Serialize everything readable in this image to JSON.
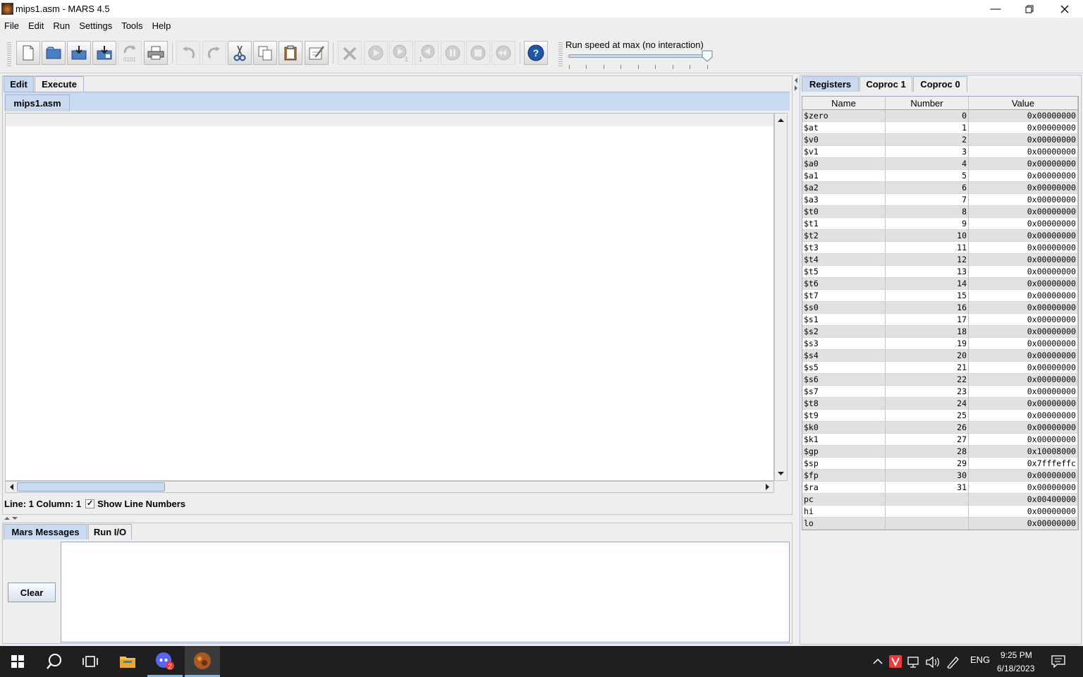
{
  "window": {
    "title": "mips1.asm  - MARS 4.5"
  },
  "menu": [
    "File",
    "Edit",
    "Run",
    "Settings",
    "Tools",
    "Help"
  ],
  "toolbar": {
    "speed_label": "Run speed at max (no interaction)",
    "speed_level_percent": 100,
    "assemble_glyph": "0101",
    "step_glyph": "1",
    "help_glyph": "?",
    "icons": [
      "new-file-icon",
      "open-icon",
      "save-icon",
      "save-as-icon",
      "dump-memory-icon",
      "print-icon",
      "undo-icon",
      "redo-icon",
      "cut-icon",
      "copy-icon",
      "paste-icon",
      "find-replace-icon",
      "assemble-icon",
      "run-icon",
      "step-icon",
      "backstep-icon",
      "pause-icon",
      "stop-icon",
      "reset-icon",
      "help-icon"
    ]
  },
  "left": {
    "tabs": {
      "edit": "Edit",
      "execute": "Execute"
    },
    "file_tab": "mips1.asm",
    "status": {
      "position": "Line: 1 Column: 1",
      "check_mark": "✓",
      "show_line_numbers": "Show Line Numbers"
    }
  },
  "messages": {
    "tabs": {
      "mars": "Mars Messages",
      "runio": "Run I/O"
    },
    "clear_label": "Clear"
  },
  "registers": {
    "tabs": {
      "registers": "Registers",
      "coproc1": "Coproc 1",
      "coproc0": "Coproc 0"
    },
    "headers": {
      "name": "Name",
      "number": "Number",
      "value": "Value"
    },
    "rows": [
      {
        "name": "$zero",
        "number": "0",
        "value": "0x00000000"
      },
      {
        "name": "$at",
        "number": "1",
        "value": "0x00000000"
      },
      {
        "name": "$v0",
        "number": "2",
        "value": "0x00000000"
      },
      {
        "name": "$v1",
        "number": "3",
        "value": "0x00000000"
      },
      {
        "name": "$a0",
        "number": "4",
        "value": "0x00000000"
      },
      {
        "name": "$a1",
        "number": "5",
        "value": "0x00000000"
      },
      {
        "name": "$a2",
        "number": "6",
        "value": "0x00000000"
      },
      {
        "name": "$a3",
        "number": "7",
        "value": "0x00000000"
      },
      {
        "name": "$t0",
        "number": "8",
        "value": "0x00000000"
      },
      {
        "name": "$t1",
        "number": "9",
        "value": "0x00000000"
      },
      {
        "name": "$t2",
        "number": "10",
        "value": "0x00000000"
      },
      {
        "name": "$t3",
        "number": "11",
        "value": "0x00000000"
      },
      {
        "name": "$t4",
        "number": "12",
        "value": "0x00000000"
      },
      {
        "name": "$t5",
        "number": "13",
        "value": "0x00000000"
      },
      {
        "name": "$t6",
        "number": "14",
        "value": "0x00000000"
      },
      {
        "name": "$t7",
        "number": "15",
        "value": "0x00000000"
      },
      {
        "name": "$s0",
        "number": "16",
        "value": "0x00000000"
      },
      {
        "name": "$s1",
        "number": "17",
        "value": "0x00000000"
      },
      {
        "name": "$s2",
        "number": "18",
        "value": "0x00000000"
      },
      {
        "name": "$s3",
        "number": "19",
        "value": "0x00000000"
      },
      {
        "name": "$s4",
        "number": "20",
        "value": "0x00000000"
      },
      {
        "name": "$s5",
        "number": "21",
        "value": "0x00000000"
      },
      {
        "name": "$s6",
        "number": "22",
        "value": "0x00000000"
      },
      {
        "name": "$s7",
        "number": "23",
        "value": "0x00000000"
      },
      {
        "name": "$t8",
        "number": "24",
        "value": "0x00000000"
      },
      {
        "name": "$t9",
        "number": "25",
        "value": "0x00000000"
      },
      {
        "name": "$k0",
        "number": "26",
        "value": "0x00000000"
      },
      {
        "name": "$k1",
        "number": "27",
        "value": "0x00000000"
      },
      {
        "name": "$gp",
        "number": "28",
        "value": "0x10008000"
      },
      {
        "name": "$sp",
        "number": "29",
        "value": "0x7fffeffc"
      },
      {
        "name": "$fp",
        "number": "30",
        "value": "0x00000000"
      },
      {
        "name": "$ra",
        "number": "31",
        "value": "0x00000000"
      },
      {
        "name": "pc",
        "number": "",
        "value": "0x00400000"
      },
      {
        "name": "hi",
        "number": "",
        "value": "0x00000000"
      },
      {
        "name": "lo",
        "number": "",
        "value": "0x00000000"
      }
    ]
  },
  "taskbar": {
    "language": "ENG",
    "time": "9:25 PM",
    "date": "6/18/2023",
    "discord_badge": "2"
  },
  "colors": {
    "selected_tab": "#c9daf0",
    "taskbar": "#1f1f1f",
    "alt_row": "#e1e1e1",
    "help_blue": "#1e56a8"
  }
}
